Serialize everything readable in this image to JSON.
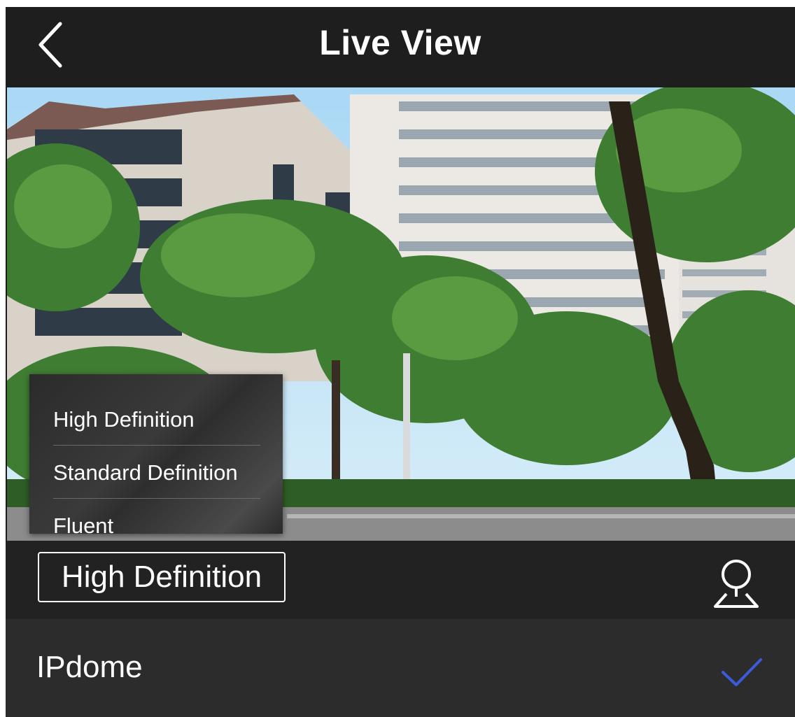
{
  "header": {
    "title": "Live View",
    "back_icon": "chevron-left-icon"
  },
  "video": {
    "description_icon": "camera-feed"
  },
  "quality_menu": {
    "items": [
      {
        "label": "High Definition"
      },
      {
        "label": "Standard Definition"
      },
      {
        "label": "Fluent"
      }
    ]
  },
  "control_bar": {
    "quality_label": "High Definition",
    "camera_icon": "dome-camera-icon"
  },
  "device": {
    "name": "IPdome",
    "check_icon": "checkmark-icon",
    "check_color": "#3b5bdb"
  },
  "colors": {
    "header_bg": "#1e1e1e",
    "control_bg": "#222222",
    "device_bg": "#2c2c2c",
    "accent": "#3b5bdb"
  }
}
